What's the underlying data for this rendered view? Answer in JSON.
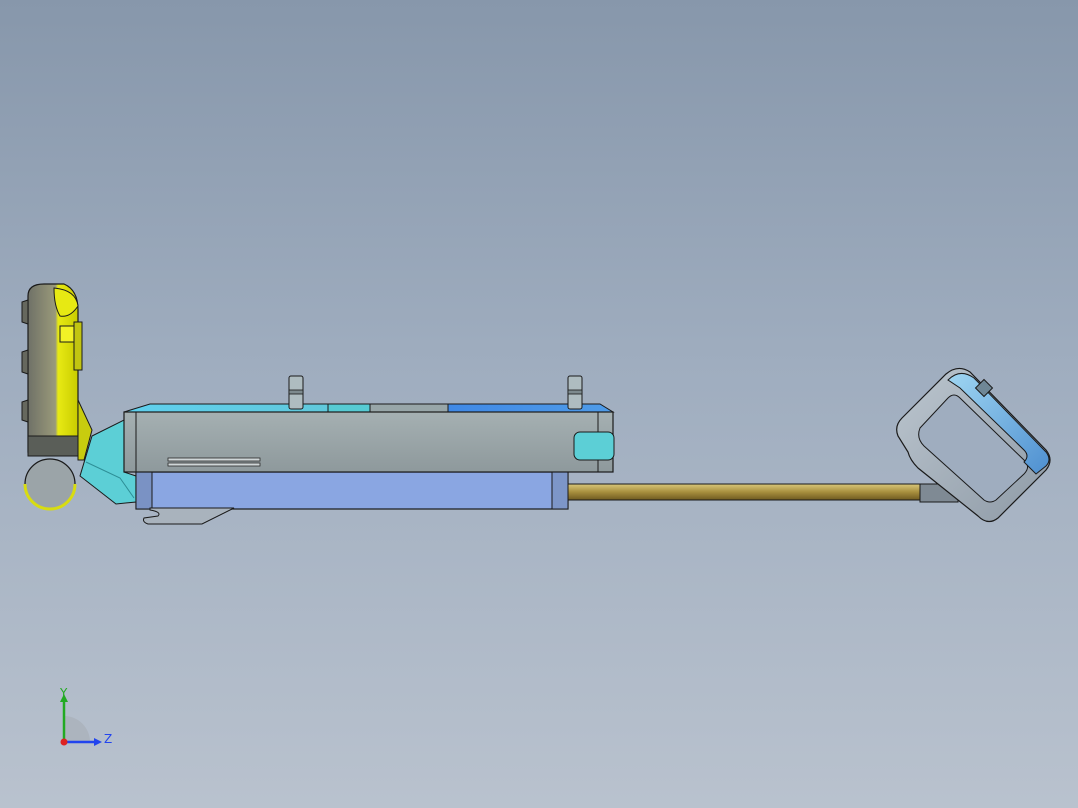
{
  "viewport": {
    "background_top": "#8797ab",
    "background_bottom": "#b9c2ce"
  },
  "model": {
    "parts": [
      {
        "name": "yellow-handle-assembly",
        "color": "#d8dc10"
      },
      {
        "name": "cyan-link-bracket",
        "color": "#5ccfd6"
      },
      {
        "name": "main-housing",
        "color": "#939fa0"
      },
      {
        "name": "lower-blue-rail",
        "color": "#8aa6e2"
      },
      {
        "name": "brass-rod",
        "color": "#b19a4a"
      },
      {
        "name": "right-grip-handle",
        "color": "#a7b2bd"
      },
      {
        "name": "top-pins",
        "color": "#aebcc0"
      }
    ]
  },
  "triad": {
    "y_label": "Y",
    "z_label": "Z",
    "colors": {
      "y": "#22aa22",
      "z": "#2244ee",
      "x": "#dd2222"
    }
  }
}
